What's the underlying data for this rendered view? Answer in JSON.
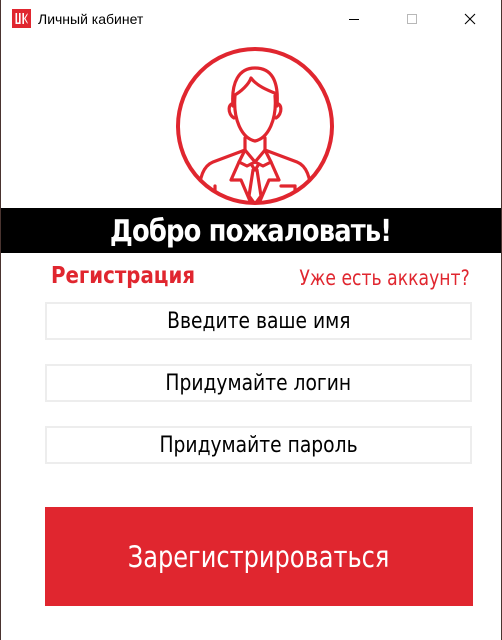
{
  "window": {
    "title": "Личный кабинет",
    "logo_icon": "lukoil-logo-icon",
    "controls": [
      "minimize-icon",
      "maximize-icon",
      "close-icon"
    ]
  },
  "avatar": {
    "icon": "user-avatar-icon",
    "color": "#e0262f"
  },
  "banner": {
    "text": "Добро пожаловать!"
  },
  "form": {
    "title": "Регистрация",
    "login_link": "Уже есть аккаунт?",
    "fields": {
      "name_placeholder": "Введите ваше имя",
      "login_placeholder": "Придумайте логин",
      "password_placeholder": "Придумайте пароль"
    },
    "submit_label": "Зарегистрироваться"
  },
  "colors": {
    "accent": "#e0262f",
    "banner_bg": "#000000",
    "field_border": "#ededed"
  }
}
